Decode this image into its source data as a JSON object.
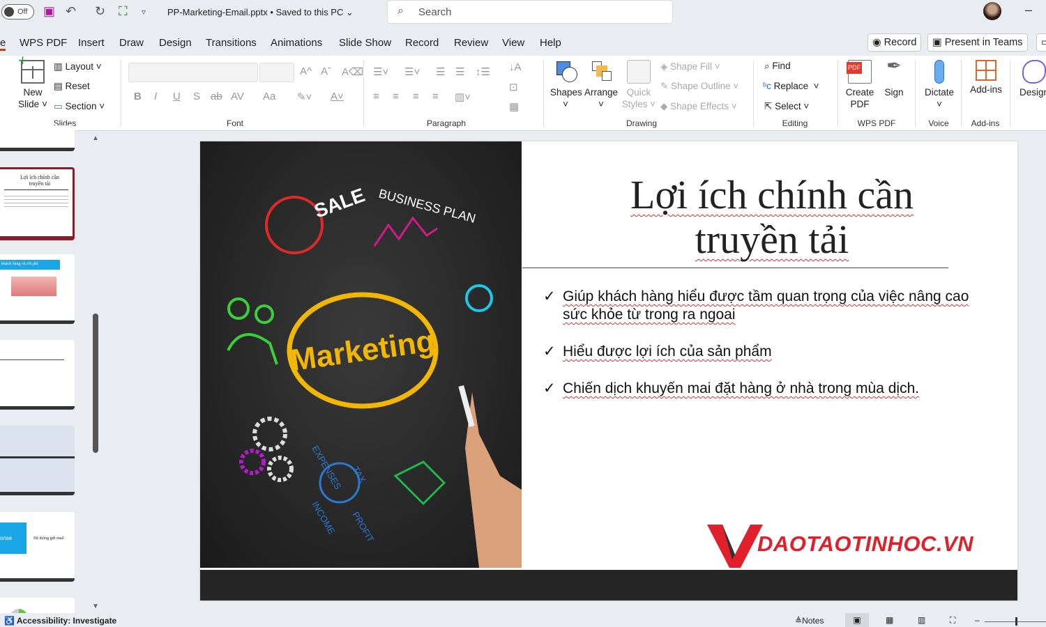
{
  "titlebar": {
    "autosave_label": "Off",
    "document_title": "PP-Marketing-Email.pptx • Saved to this PC ⌄",
    "search_placeholder": "Search",
    "minimize": "–"
  },
  "tabs": [
    "e",
    "WPS PDF",
    "Insert",
    "Draw",
    "Design",
    "Transitions",
    "Animations",
    "Slide Show",
    "Record",
    "Review",
    "View",
    "Help"
  ],
  "tab_buttons": {
    "record": "◉ Record",
    "present": "Present in Teams"
  },
  "ribbon": {
    "slides": {
      "new_slide": "New Slide ˅",
      "layout": "Layout ˅",
      "reset": "Reset",
      "section": "Section ˅",
      "label": "Slides"
    },
    "font": {
      "label": "Font",
      "bold": "B",
      "italic": "I",
      "underline": "U",
      "shadow": "S",
      "strike": "ab",
      "spacing": "AV",
      "case": "Aa",
      "grow": "A^",
      "shrink": "Aˇ"
    },
    "paragraph": {
      "label": "Paragraph"
    },
    "drawing": {
      "shapes": "Shapes",
      "arrange": "Arrange",
      "quick_styles": "Quick Styles ˅",
      "shape_fill": "Shape Fill ˅",
      "shape_outline": "Shape Outline ˅",
      "shape_effects": "Shape Effects ˅",
      "label": "Drawing"
    },
    "editing": {
      "find": "Find",
      "replace": "Replace",
      "select": "Select ˅",
      "label": "Editing"
    },
    "wps_pdf": {
      "create_pdf": "Create PDF",
      "sign": "Sign",
      "label": "WPS PDF"
    },
    "voice": {
      "dictate": "Dictate",
      "label": "Voice"
    },
    "addins": {
      "addins": "Add-ins",
      "label": "Add-ins"
    },
    "designer": {
      "design": "Design"
    }
  },
  "thumbnails": {
    "t2_title": "Lợi ích chính cần truyền tải",
    "t3_title": "khách hàng và chi phí",
    "t6_left": "onse",
    "t6_right": "Hệ thống gửi mail"
  },
  "slide": {
    "title": "Lợi ích chính cần truyền tải",
    "bullets": [
      "Giúp khách hàng hiểu được tầm quan trọng của việc nâng cao sức khỏe từ trong ra ngoai",
      "Hiểu được lợi ích của sản phẩm",
      "Chiến dịch khuyến mai đặt hàng ở nhà trong mùa dịch."
    ],
    "check": "✓",
    "image_words": {
      "center": "Marketing",
      "sale": "SALE",
      "business": "BUSINESS PLAN",
      "expenses": "EXPENSES",
      "tax": "TAX",
      "income": "INCOME",
      "profit": "PROFIT"
    },
    "logo_text": "DAOTAOTINHOC.VN"
  },
  "status": {
    "accessibility": "Accessibility: Investigate",
    "notes": "Notes"
  },
  "colors": {
    "accent": "#c43e1c",
    "logo_red": "#e0202a",
    "selected_thumb": "#8a1c2b"
  }
}
